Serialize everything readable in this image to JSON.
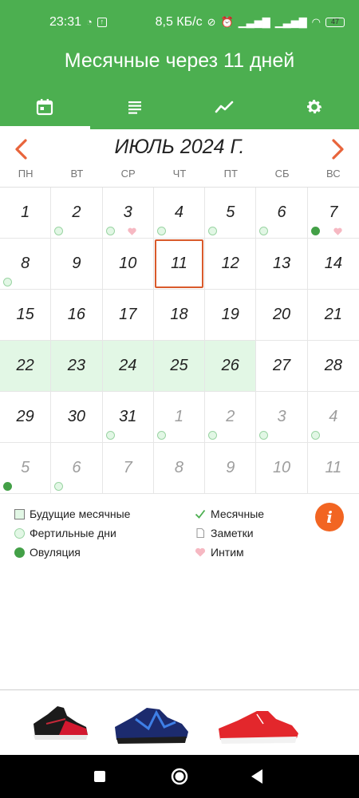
{
  "status_bar": {
    "time": "23:31",
    "speed": "8,5 КБ/с",
    "battery": "47",
    "battery_level": 0.47
  },
  "header": {
    "title": "Месячные через 11 дней",
    "tabs": [
      {
        "icon": "calendar-icon",
        "active": true
      },
      {
        "icon": "list-icon",
        "active": false
      },
      {
        "icon": "chart-icon",
        "active": false
      },
      {
        "icon": "gear-icon",
        "active": false
      }
    ]
  },
  "calendar": {
    "month_title": "ИЮЛЬ 2024 Г.",
    "weekdays": [
      "ПН",
      "ВТ",
      "СР",
      "ЧТ",
      "ПТ",
      "СБ",
      "ВС"
    ],
    "days": [
      {
        "n": "1",
        "other": false,
        "future": false,
        "today": false,
        "dot": "",
        "heart": false
      },
      {
        "n": "2",
        "other": false,
        "future": false,
        "today": false,
        "dot": "fertile",
        "heart": false
      },
      {
        "n": "3",
        "other": false,
        "future": false,
        "today": false,
        "dot": "fertile",
        "heart": true
      },
      {
        "n": "4",
        "other": false,
        "future": false,
        "today": false,
        "dot": "fertile",
        "heart": false
      },
      {
        "n": "5",
        "other": false,
        "future": false,
        "today": false,
        "dot": "fertile",
        "heart": false
      },
      {
        "n": "6",
        "other": false,
        "future": false,
        "today": false,
        "dot": "fertile",
        "heart": false
      },
      {
        "n": "7",
        "other": false,
        "future": false,
        "today": false,
        "dot": "ovulation",
        "heart": true
      },
      {
        "n": "8",
        "other": false,
        "future": false,
        "today": false,
        "dot": "fertile",
        "heart": false
      },
      {
        "n": "9",
        "other": false,
        "future": false,
        "today": false,
        "dot": "",
        "heart": false
      },
      {
        "n": "10",
        "other": false,
        "future": false,
        "today": false,
        "dot": "",
        "heart": false
      },
      {
        "n": "11",
        "other": false,
        "future": false,
        "today": true,
        "dot": "",
        "heart": false
      },
      {
        "n": "12",
        "other": false,
        "future": false,
        "today": false,
        "dot": "",
        "heart": false
      },
      {
        "n": "13",
        "other": false,
        "future": false,
        "today": false,
        "dot": "",
        "heart": false
      },
      {
        "n": "14",
        "other": false,
        "future": false,
        "today": false,
        "dot": "",
        "heart": false
      },
      {
        "n": "15",
        "other": false,
        "future": false,
        "today": false,
        "dot": "",
        "heart": false
      },
      {
        "n": "16",
        "other": false,
        "future": false,
        "today": false,
        "dot": "",
        "heart": false
      },
      {
        "n": "17",
        "other": false,
        "future": false,
        "today": false,
        "dot": "",
        "heart": false
      },
      {
        "n": "18",
        "other": false,
        "future": false,
        "today": false,
        "dot": "",
        "heart": false
      },
      {
        "n": "19",
        "other": false,
        "future": false,
        "today": false,
        "dot": "",
        "heart": false
      },
      {
        "n": "20",
        "other": false,
        "future": false,
        "today": false,
        "dot": "",
        "heart": false
      },
      {
        "n": "21",
        "other": false,
        "future": false,
        "today": false,
        "dot": "",
        "heart": false
      },
      {
        "n": "22",
        "other": false,
        "future": true,
        "today": false,
        "dot": "",
        "heart": false
      },
      {
        "n": "23",
        "other": false,
        "future": true,
        "today": false,
        "dot": "",
        "heart": false
      },
      {
        "n": "24",
        "other": false,
        "future": true,
        "today": false,
        "dot": "",
        "heart": false
      },
      {
        "n": "25",
        "other": false,
        "future": true,
        "today": false,
        "dot": "",
        "heart": false
      },
      {
        "n": "26",
        "other": false,
        "future": true,
        "today": false,
        "dot": "",
        "heart": false
      },
      {
        "n": "27",
        "other": false,
        "future": false,
        "today": false,
        "dot": "",
        "heart": false
      },
      {
        "n": "28",
        "other": false,
        "future": false,
        "today": false,
        "dot": "",
        "heart": false
      },
      {
        "n": "29",
        "other": false,
        "future": false,
        "today": false,
        "dot": "",
        "heart": false
      },
      {
        "n": "30",
        "other": false,
        "future": false,
        "today": false,
        "dot": "",
        "heart": false
      },
      {
        "n": "31",
        "other": false,
        "future": false,
        "today": false,
        "dot": "fertile",
        "heart": false
      },
      {
        "n": "1",
        "other": true,
        "future": false,
        "today": false,
        "dot": "fertile",
        "heart": false
      },
      {
        "n": "2",
        "other": true,
        "future": false,
        "today": false,
        "dot": "fertile",
        "heart": false
      },
      {
        "n": "3",
        "other": true,
        "future": false,
        "today": false,
        "dot": "fertile",
        "heart": false
      },
      {
        "n": "4",
        "other": true,
        "future": false,
        "today": false,
        "dot": "fertile",
        "heart": false
      },
      {
        "n": "5",
        "other": true,
        "future": false,
        "today": false,
        "dot": "ovulation",
        "heart": false
      },
      {
        "n": "6",
        "other": true,
        "future": false,
        "today": false,
        "dot": "fertile",
        "heart": false
      },
      {
        "n": "7",
        "other": true,
        "future": false,
        "today": false,
        "dot": "",
        "heart": false
      },
      {
        "n": "8",
        "other": true,
        "future": false,
        "today": false,
        "dot": "",
        "heart": false
      },
      {
        "n": "9",
        "other": true,
        "future": false,
        "today": false,
        "dot": "",
        "heart": false
      },
      {
        "n": "10",
        "other": true,
        "future": false,
        "today": false,
        "dot": "",
        "heart": false
      },
      {
        "n": "11",
        "other": true,
        "future": false,
        "today": false,
        "dot": "",
        "heart": false
      }
    ]
  },
  "legend": {
    "future_periods": "Будущие месячные",
    "fertile_days": "Фертильные дни",
    "ovulation": "Овуляция",
    "periods": "Месячные",
    "notes": "Заметки",
    "intimacy": "Интим",
    "info": "i"
  },
  "colors": {
    "primary": "#4caf50",
    "accent": "#d95a2b",
    "future_fill": "#e2f7e5",
    "ovulation": "#43a047",
    "heart": "#f6b8c2"
  },
  "ad": {
    "items": [
      "shoe-black-red-icon",
      "shoe-blue-icon",
      "shoe-red-icon"
    ]
  }
}
